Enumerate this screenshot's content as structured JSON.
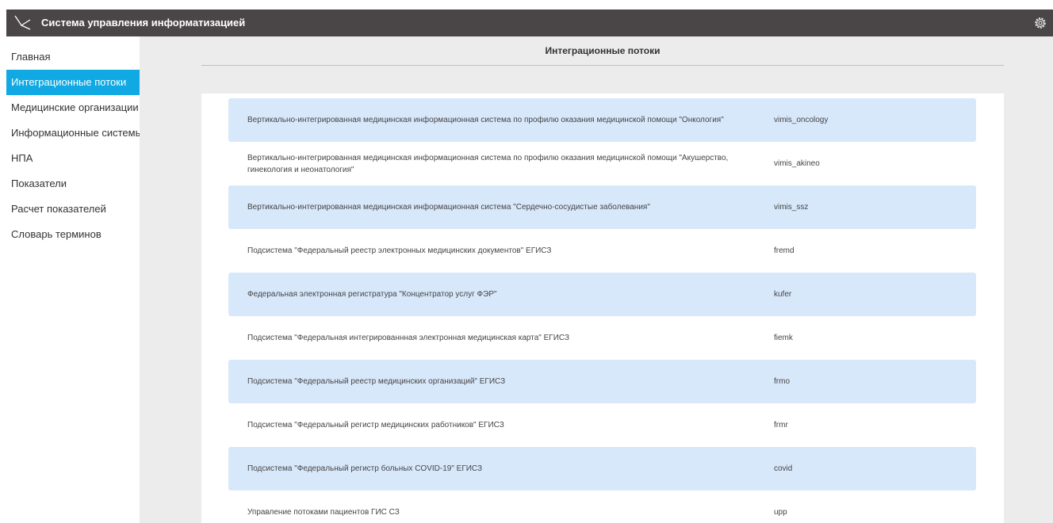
{
  "header": {
    "app_title": "Система управления информатизацией",
    "logo_icon": "branch-logo-icon",
    "settings_icon": "gear-icon"
  },
  "sidebar": {
    "items": [
      {
        "label": "Главная",
        "active": false
      },
      {
        "label": "Интеграционные потоки",
        "active": true
      },
      {
        "label": "Медицинские организации",
        "active": false
      },
      {
        "label": "Информационные системы",
        "active": false
      },
      {
        "label": "НПА",
        "active": false
      },
      {
        "label": "Показатели",
        "active": false
      },
      {
        "label": "Расчет показателей",
        "active": false
      },
      {
        "label": "Словарь терминов",
        "active": false
      }
    ]
  },
  "main": {
    "title": "Интеграционные потоки",
    "rows": [
      {
        "name": "Вертикально-интегрированная медицинская информационная система по профилю оказания медицинской помощи \"Онкология\"",
        "code": "vimis_oncology"
      },
      {
        "name": "Вертикально-интегрированная медицинская информационная система по профилю оказания медицинской помощи \"Акушерство, гинекология и неонатология\"",
        "code": "vimis_akineo"
      },
      {
        "name": "Вертикально-интегрированная медицинская информационная система \"Сердечно-сосудистые заболевания\"",
        "code": "vimis_ssz"
      },
      {
        "name": "Подсистема \"Федеральный реестр электронных медицинских документов\" ЕГИСЗ",
        "code": "fremd"
      },
      {
        "name": "Федеральная электронная регистратура \"Концентратор услуг ФЭР\"",
        "code": "kufer"
      },
      {
        "name": "Подсистема \"Федеральная интегрированнная электронная медицинская карта\" ЕГИСЗ",
        "code": "fiemk"
      },
      {
        "name": "Подсистема \"Федеральный реестр медицинских организаций\" ЕГИСЗ",
        "code": "frmo"
      },
      {
        "name": "Подсистема \"Федеральный регистр медицинских работников\" ЕГИСЗ",
        "code": "frmr"
      },
      {
        "name": "Подсистема \"Федеральный регистр больных COVID-19\" ЕГИСЗ",
        "code": "covid"
      },
      {
        "name": "Управление потоками пациентов ГИС СЗ",
        "code": "upp"
      }
    ]
  },
  "colors": {
    "header_bg": "#4a4547",
    "active_nav": "#11a9e4",
    "row_highlight": "#d8e8fb",
    "main_bg": "#ececec"
  }
}
